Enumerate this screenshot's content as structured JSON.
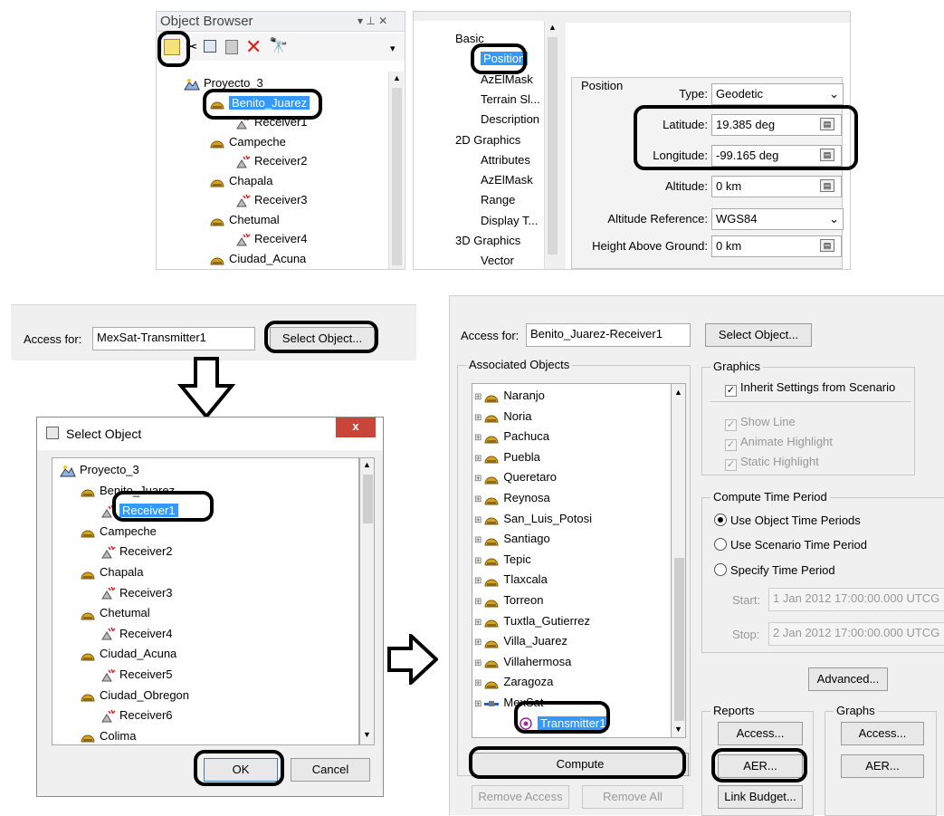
{
  "object_browser": {
    "title": "Object Browser",
    "title_controls": "▾ ⊥ ✕",
    "tree": [
      {
        "label": "Proyecto_3",
        "level": 0
      },
      {
        "label": "Benito_Juarez",
        "level": 1
      },
      {
        "label": "Receiver1",
        "level": 2
      },
      {
        "label": "Campeche",
        "level": 1
      },
      {
        "label": "Receiver2",
        "level": 2
      },
      {
        "label": "Chapala",
        "level": 1
      },
      {
        "label": "Receiver3",
        "level": 2
      },
      {
        "label": "Chetumal",
        "level": 1
      },
      {
        "label": "Receiver4",
        "level": 2
      },
      {
        "label": "Ciudad_Acuna",
        "level": 1
      }
    ]
  },
  "properties": {
    "nav": [
      {
        "label": "Basic",
        "level": 0
      },
      {
        "label": "Position",
        "level": 1
      },
      {
        "label": "AzElMask",
        "level": 1
      },
      {
        "label": "Terrain Sl...",
        "level": 1
      },
      {
        "label": "Description",
        "level": 1
      },
      {
        "label": "2D Graphics",
        "level": 0
      },
      {
        "label": "Attributes",
        "level": 1
      },
      {
        "label": "AzElMask",
        "level": 1
      },
      {
        "label": "Range",
        "level": 1
      },
      {
        "label": "Display T...",
        "level": 1
      },
      {
        "label": "3D Graphics",
        "level": 0
      },
      {
        "label": "Vector",
        "level": 1
      }
    ],
    "group_title": "Position",
    "type_label": "Type:",
    "type_value": "Geodetic",
    "latitude_label": "Latitude:",
    "latitude_value": "19.385 deg",
    "longitude_label": "Longitude:",
    "longitude_value": "-99.165 deg",
    "altitude_label": "Altitude:",
    "altitude_value": "0 km",
    "altref_label": "Altitude Reference:",
    "altref_value": "WGS84",
    "hag_label": "Height Above Ground:",
    "hag_value": "0 km"
  },
  "access_small": {
    "label": "Access for:",
    "value": "MexSat-Transmitter1",
    "button": "Select Object..."
  },
  "select_dialog": {
    "title": "Select Object",
    "close": "x",
    "tree": [
      {
        "label": "Proyecto_3",
        "level": 0
      },
      {
        "label": "Benito_Juarez",
        "level": 1
      },
      {
        "label": "Receiver1",
        "level": 2
      },
      {
        "label": "Campeche",
        "level": 1
      },
      {
        "label": "Receiver2",
        "level": 2
      },
      {
        "label": "Chapala",
        "level": 1
      },
      {
        "label": "Receiver3",
        "level": 2
      },
      {
        "label": "Chetumal",
        "level": 1
      },
      {
        "label": "Receiver4",
        "level": 2
      },
      {
        "label": "Ciudad_Acuna",
        "level": 1
      },
      {
        "label": "Receiver5",
        "level": 2
      },
      {
        "label": "Ciudad_Obregon",
        "level": 1
      },
      {
        "label": "Receiver6",
        "level": 2
      },
      {
        "label": "Colima",
        "level": 1
      }
    ],
    "ok": "OK",
    "cancel": "Cancel"
  },
  "access_panel": {
    "label": "Access for:",
    "value": "Benito_Juarez-Receiver1",
    "select_button": "Select Object...",
    "assoc_title": "Associated Objects",
    "objects": [
      "Naranjo",
      "Noria",
      "Pachuca",
      "Puebla",
      "Queretaro",
      "Reynosa",
      "San_Luis_Potosi",
      "Santiago",
      "Tepic",
      "Tlaxcala",
      "Torreon",
      "Tuxtla_Gutierrez",
      "Villa_Juarez",
      "Villahermosa",
      "Zaragoza",
      "MexSat"
    ],
    "transmitter": "Transmitter1",
    "compute": "Compute",
    "remove_access": "Remove Access",
    "remove_all": "Remove All",
    "graphics_title": "Graphics",
    "inherit": "Inherit Settings from Scenario",
    "show_line": "Show Line",
    "animate": "Animate Highlight",
    "static": "Static Highlight",
    "ctp_title": "Compute Time Period",
    "use_object": "Use Object Time Periods",
    "use_scenario": "Use Scenario Time Period",
    "specify": "Specify Time Period",
    "start_label": "Start:",
    "start_value": "1 Jan 2012 17:00:00.000 UTCG",
    "stop_label": "Stop:",
    "stop_value": "2 Jan 2012 17:00:00.000 UTCG",
    "advanced": "Advanced...",
    "reports_title": "Reports",
    "graphs_title": "Graphs",
    "rep_access": "Access...",
    "rep_aer": "AER...",
    "link_budget": "Link Budget...",
    "gr_access": "Access...",
    "gr_aer": "AER..."
  },
  "colors": {
    "selection": "#3399ff",
    "highlight_border": "#000000",
    "panel_bg": "#f0f0f0"
  }
}
